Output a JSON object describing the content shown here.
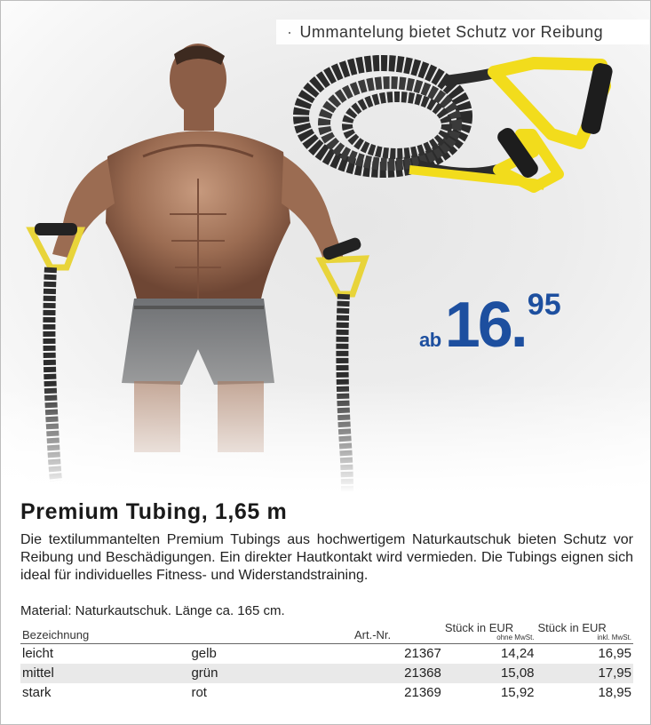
{
  "feature_note": "Ummantelung bietet Schutz vor Reibung",
  "price": {
    "prefix": "ab",
    "main": "16.",
    "cents": "95"
  },
  "product": {
    "title": "Premium Tubing, 1,65 m",
    "description": "Die textilummantelten Premium Tubings aus hochwertigem Naturkautschuk bieten Schutz vor Reibung und Beschädigungen. Ein direkter Hautkontakt wird vermieden. Die Tubings eignen sich ideal für individuelles Fitness- und Widerstandstraining.",
    "material": "Material: Naturkautschuk. Länge ca. 165 cm."
  },
  "table": {
    "headers": {
      "name": "Bezeichnung",
      "art": "Art.-Nr.",
      "net_top": "Stück in EUR",
      "net_sub": "ohne MwSt.",
      "gross_top": "Stück in EUR",
      "gross_sub": "inkl. MwSt."
    },
    "rows": [
      {
        "name": "leicht",
        "color": "gelb",
        "art": "21367",
        "net": "14,24",
        "gross": "16,95"
      },
      {
        "name": "mittel",
        "color": "grün",
        "art": "21368",
        "net": "15,08",
        "gross": "17,95"
      },
      {
        "name": "stark",
        "color": "rot",
        "art": "21369",
        "net": "15,92",
        "gross": "18,95"
      }
    ]
  },
  "colors": {
    "price_blue": "#1d4f9f",
    "band_yellow": "#f2dc1c",
    "row_shade": "#e9e9e9"
  }
}
